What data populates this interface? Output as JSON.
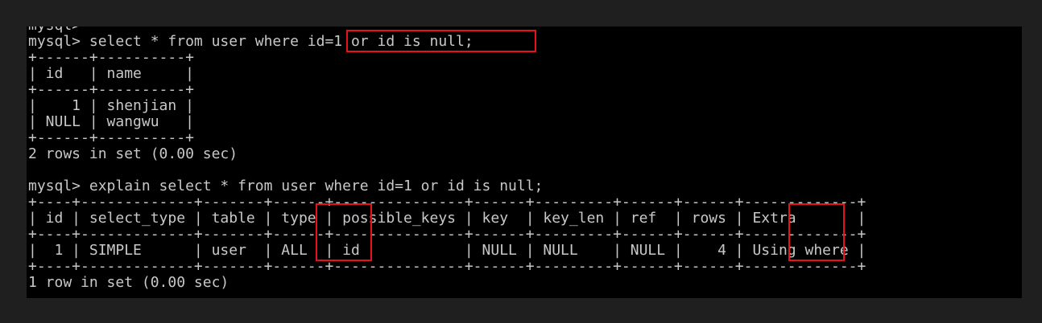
{
  "terminal": {
    "lines": [
      "mysql>",
      "mysql> select * from user where id=1 or id is null;",
      "+------+----------+",
      "| id   | name     |",
      "+------+----------+",
      "|    1 | shenjian |",
      "| NULL | wangwu   |",
      "+------+----------+",
      "2 rows in set (0.00 sec)",
      "",
      "mysql> explain select * from user where id=1 or id is null;",
      "+----+-------------+-------+------+---------------+------+---------+------+------+-------------+",
      "| id | select_type | table | type | possible_keys | key  | key_len | ref  | rows | Extra       |",
      "+----+-------------+-------+------+---------------+------+---------+------+------+-------------+",
      "|  1 | SIMPLE      | user  | ALL  | id            | NULL | NULL    | NULL |    4 | Using where |",
      "+----+-------------+-------+------+---------------+------+---------+------+------+-------------+",
      "1 row in set (0.00 sec)"
    ]
  },
  "highlight_color": "#e8121a",
  "annotations": [
    {
      "name": "where-condition",
      "marks": "id=1 or id is null"
    },
    {
      "name": "type-column",
      "marks": "type / ALL"
    },
    {
      "name": "rows-column",
      "marks": "rows / 4"
    }
  ]
}
